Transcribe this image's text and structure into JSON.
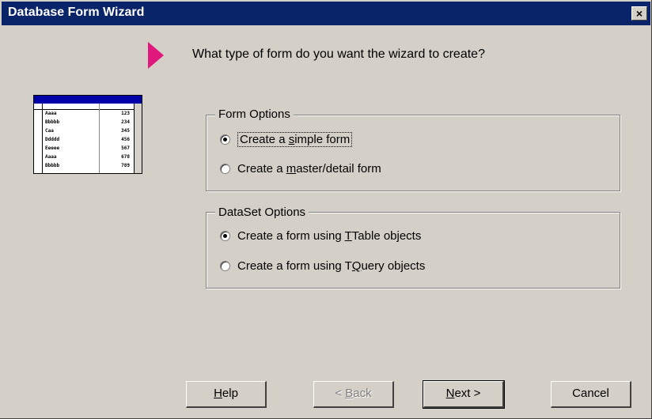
{
  "window": {
    "title": "Database Form Wizard",
    "close_label": "×"
  },
  "prompt": "What type of form do you want the wizard to create?",
  "thumbnail": {
    "rows": [
      {
        "name": "Aaaa",
        "value": "123"
      },
      {
        "name": "Bbbbb",
        "value": "234"
      },
      {
        "name": "Caa",
        "value": "345"
      },
      {
        "name": "Ddddd",
        "value": "456"
      },
      {
        "name": "Eeeee",
        "value": "567"
      },
      {
        "name": "Aaaa",
        "value": "678"
      },
      {
        "name": "Bbbbb",
        "value": "789"
      }
    ]
  },
  "form_options": {
    "legend": "Form Options",
    "simple": {
      "pre": "Create a ",
      "key": "s",
      "post": "imple form",
      "checked": true
    },
    "master": {
      "pre": "Create a ",
      "key": "m",
      "post": "aster/detail form",
      "checked": false
    }
  },
  "dataset_options": {
    "legend": "DataSet Options",
    "ttable": {
      "pre": "Create a form using ",
      "key": "T",
      "post": "Table objects",
      "checked": true
    },
    "tquery": {
      "pre": "Create a form using T",
      "key": "Q",
      "post": "uery objects",
      "checked": false
    }
  },
  "buttons": {
    "help": {
      "key": "H",
      "post": "elp"
    },
    "back": {
      "pre": "< ",
      "key": "B",
      "post": "ack"
    },
    "next": {
      "key": "N",
      "post": "ext >"
    },
    "cancel": "Cancel"
  }
}
